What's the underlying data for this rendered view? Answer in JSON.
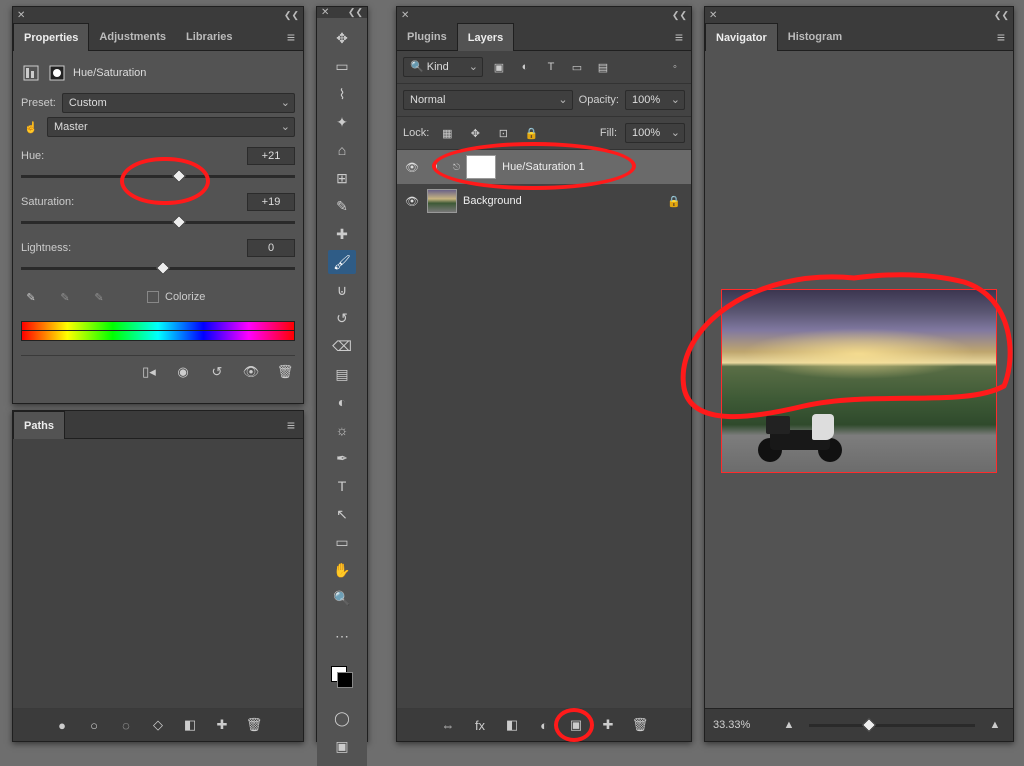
{
  "properties": {
    "tabs": [
      "Properties",
      "Adjustments",
      "Libraries"
    ],
    "active_tab": 0,
    "adj_type_label": "Hue/Saturation",
    "preset_label": "Preset:",
    "preset_value": "Custom",
    "channel_value": "Master",
    "hue_label": "Hue:",
    "hue_value": "+21",
    "saturation_label": "Saturation:",
    "saturation_value": "+19",
    "lightness_label": "Lightness:",
    "lightness_value": "0",
    "colorize_label": "Colorize",
    "eyedroppers": [
      "eyedropper",
      "eyedropper-add",
      "eyedropper-subtract"
    ],
    "paths_tab": "Paths"
  },
  "toolbar": {
    "tools": [
      "move-tool",
      "rectangular-marquee-tool",
      "lasso-tool",
      "object-selection-tool",
      "crop-tool",
      "frame-tool",
      "eyedropper-tool",
      "spot-healing-brush-tool",
      "brush-tool",
      "clone-stamp-tool",
      "history-brush-tool",
      "eraser-tool",
      "gradient-tool",
      "blur-tool",
      "dodge-tool",
      "pen-tool",
      "type-tool",
      "path-selection-tool",
      "rectangle-tool",
      "hand-tool",
      "zoom-tool",
      "edit-toolbar",
      "foreground-background-colors",
      "quick-mask-mode",
      "screen-mode"
    ],
    "glyphs": [
      "✥",
      "▭",
      "⌇",
      "✦",
      "⌂",
      "⊞",
      "✎",
      "✚",
      "🖌",
      "⊍",
      "↺",
      "⌫",
      "▤",
      "◐",
      "☼",
      "✒",
      "T",
      "↖",
      "▭",
      "✋",
      "🔍",
      "⋯",
      "◧",
      "◯",
      "▣"
    ],
    "selected_index": 8
  },
  "layers": {
    "tabs": [
      "Plugins",
      "Layers"
    ],
    "active_tab": 1,
    "filter_label": "Kind",
    "blend_mode": "Normal",
    "opacity_label": "Opacity:",
    "opacity_value": "100%",
    "lock_label": "Lock:",
    "fill_label": "Fill:",
    "fill_value": "100%",
    "rows": [
      {
        "visible": true,
        "type": "adjustment",
        "name": "Hue/Saturation 1",
        "mask": true,
        "locked": false,
        "selected": true
      },
      {
        "visible": true,
        "type": "image",
        "name": "Background",
        "mask": false,
        "locked": true,
        "selected": false
      }
    ],
    "bottom_icons": [
      "link-layers",
      "layer-style",
      "add-mask",
      "adjustment-layer",
      "group",
      "new-layer",
      "delete-layer"
    ],
    "bottom_glyphs": [
      "⇔",
      "fx",
      "◧",
      "◐",
      "▣",
      "✚",
      "🗑"
    ]
  },
  "navigator": {
    "tabs": [
      "Navigator",
      "Histogram"
    ],
    "active_tab": 0,
    "zoom_value": "33.33%",
    "preview_alt": "motorcycle on road with mountains and dramatic sunset clouds"
  }
}
